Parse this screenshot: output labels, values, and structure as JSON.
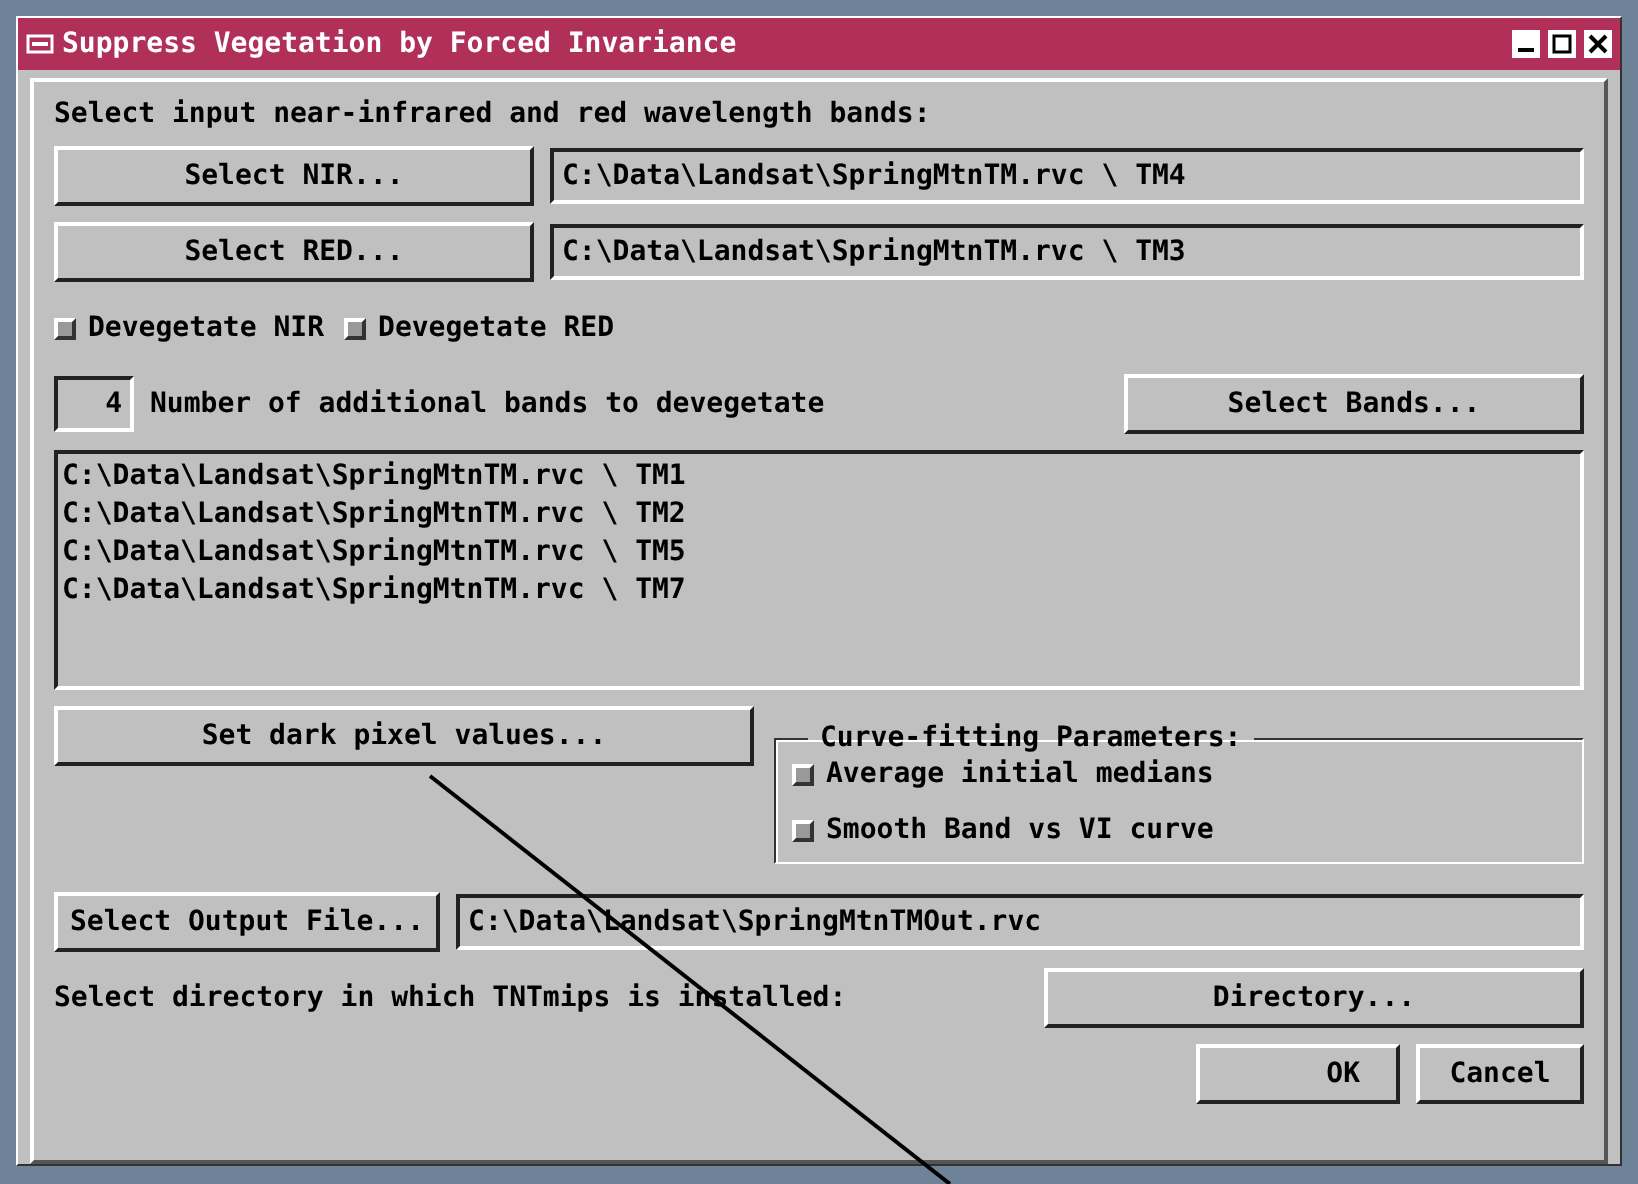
{
  "window": {
    "title": "Suppress Vegetation by Forced Invariance"
  },
  "title_buttons": [
    {
      "kind": "minimize"
    },
    {
      "kind": "maximize"
    },
    {
      "kind": "close"
    }
  ],
  "instruction": "Select input near-infrared and red wavelength bands:",
  "band_rows": [
    {
      "button": "Select NIR...",
      "value": "C:\\Data\\Landsat\\SpringMtnTM.rvc \\ TM4"
    },
    {
      "button": "Select RED...",
      "value": "C:\\Data\\Landsat\\SpringMtnTM.rvc \\ TM3"
    }
  ],
  "devegetate_options": [
    {
      "label": "Devegetate NIR",
      "checked": false
    },
    {
      "label": "Devegetate RED",
      "checked": false
    }
  ],
  "additional_bands": {
    "count": "4",
    "label": "Number of additional bands to devegetate",
    "button": "Select Bands...",
    "items": [
      "C:\\Data\\Landsat\\SpringMtnTM.rvc \\ TM1",
      "C:\\Data\\Landsat\\SpringMtnTM.rvc \\ TM2",
      "C:\\Data\\Landsat\\SpringMtnTM.rvc \\ TM5",
      "C:\\Data\\Landsat\\SpringMtnTM.rvc \\ TM7"
    ]
  },
  "dark_pixel_button": "Set dark pixel values...",
  "curve_fitting": {
    "title": "Curve-fitting Parameters:",
    "options": [
      {
        "label": "Average initial medians",
        "checked": false
      },
      {
        "label": "Smooth Band vs VI curve",
        "checked": false
      }
    ]
  },
  "output": {
    "button": "Select Output File...",
    "value": "C:\\Data\\Landsat\\SpringMtnTMOut.rvc"
  },
  "directory": {
    "label": "Select directory in which TNTmips is installed:",
    "button": "Directory..."
  },
  "buttons": [
    "OK",
    "Cancel"
  ]
}
